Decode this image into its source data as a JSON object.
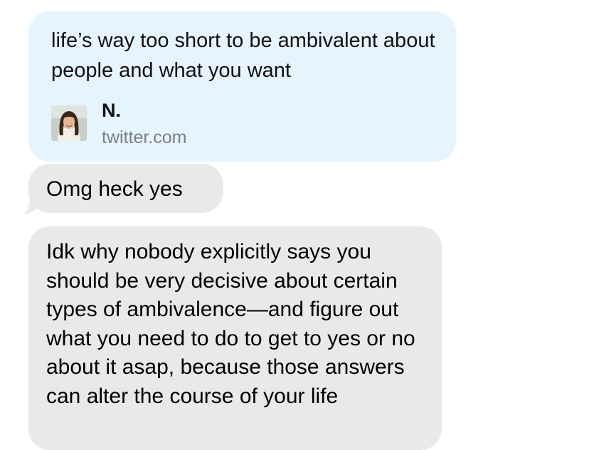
{
  "link_preview": {
    "text": "life’s way too short to be ambivalent about people and what you want",
    "name": "N.",
    "domain": "twitter.com",
    "avatar_icon": "profile-photo-icon"
  },
  "messages": [
    {
      "text": "Omg heck yes"
    },
    {
      "text": "Idk why nobody explicitly says you should be very decisive about certain types of ambivalence—and figure out what you need to do to get to yes or no about it asap, because those answers can alter the course of your life"
    }
  ],
  "colors": {
    "link_bubble": "#e6f4fd",
    "received_bubble": "#e9e9eb",
    "secondary_text": "#7b7f85"
  }
}
